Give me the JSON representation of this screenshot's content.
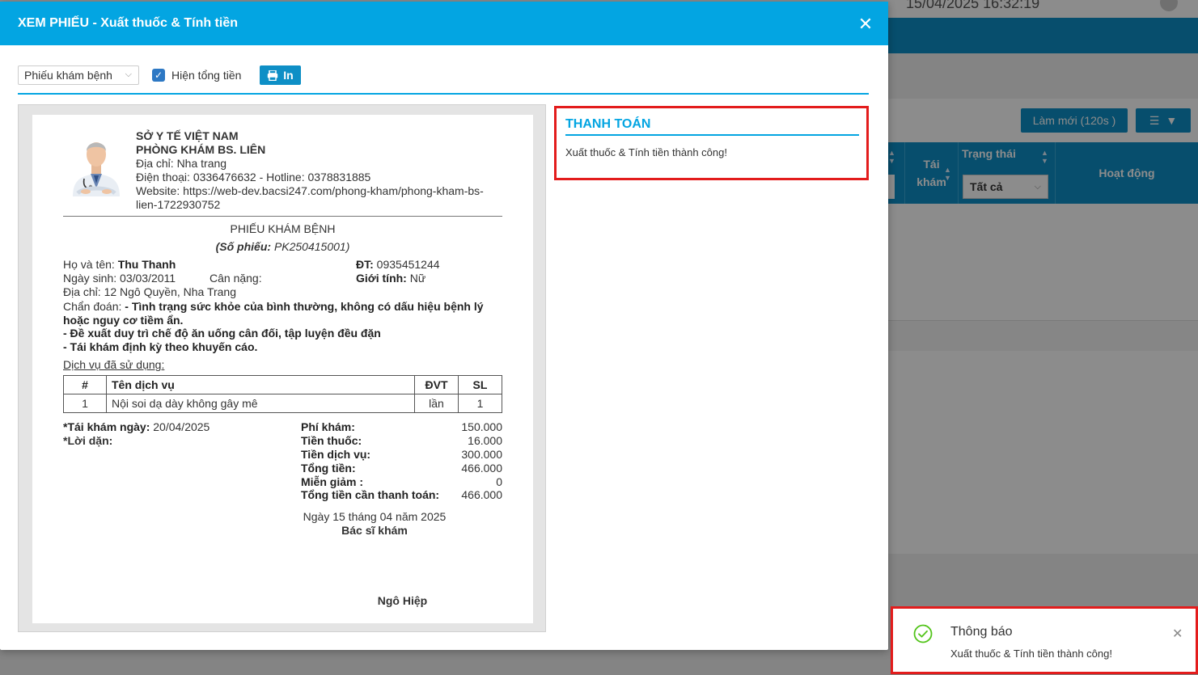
{
  "background": {
    "datetime": "15/04/2025 16:32:19",
    "refresh_button": "Làm mới (120s )",
    "columns": {
      "tai_kham": "Tái khám",
      "trang_thai": "Trạng thái",
      "hoat_dong": "Hoạt động"
    },
    "status_filter": "Tất cả"
  },
  "modal": {
    "title": "XEM PHIẾU - Xuất thuốc & Tính tiền",
    "toolbar": {
      "form_select": "Phiếu khám bệnh",
      "show_total_label": "Hiện tổng tiền",
      "print_label": "In"
    },
    "paper": {
      "org": "SỞ Y TẾ VIỆT NAM",
      "clinic": "PHÒNG KHÁM BS. LIÊN",
      "address": "Địa chỉ: Nha trang",
      "phone": "Điện thoại: 0336476632 - Hotline: 0378831885",
      "website": "Website: https://web-dev.bacsi247.com/phong-kham/phong-kham-bs-lien-1722930752",
      "doc_title": "PHIẾU KHÁM BỆNH",
      "doc_no_label": "(Số phiếu: ",
      "doc_no": "PK250415001",
      "doc_no_close": ")",
      "patient": {
        "name_label": "Họ và tên: ",
        "name": "Thu Thanh",
        "phone_label": "ĐT: ",
        "phone": "0935451244",
        "dob_label": "Ngày sinh: ",
        "dob": "03/03/2011",
        "weight_label": "Cân nặng:",
        "gender_label": "Giới tính: ",
        "gender": "Nữ",
        "address": "Địa chỉ: 12 Ngô Quyền, Nha Trang"
      },
      "diagnosis_label": "Chẩn đoán: ",
      "diagnosis_1": "- Tình trạng sức khỏe của bình thường, không có dấu hiệu bệnh lý hoặc nguy cơ tiềm ẩn.",
      "diagnosis_2": "- Đề xuất duy trì chế độ ăn uống cân đối, tập luyện đều đặn",
      "diagnosis_3": "- Tái khám định kỳ theo khuyến cáo.",
      "services_heading": "Dịch vụ đã sử dụng:",
      "services_headers": {
        "no": "#",
        "name": "Tên dịch vụ",
        "unit": "ĐVT",
        "qty": "SL"
      },
      "services": [
        {
          "no": "1",
          "name": "Nội soi dạ dày không gây mê",
          "unit": "lần",
          "qty": "1"
        }
      ],
      "revisit_label": "*Tái khám ngày: ",
      "revisit_date": "20/04/2025",
      "advice_label": "*Lời dặn:",
      "totals": [
        {
          "label": "Phí khám:",
          "value": "150.000"
        },
        {
          "label": "Tiền thuốc:",
          "value": "16.000"
        },
        {
          "label": "Tiền dịch vụ:",
          "value": "300.000"
        },
        {
          "label": "Tổng tiền:",
          "value": "466.000"
        },
        {
          "label": "Miễn giảm :",
          "value": "0"
        },
        {
          "label": "Tổng tiền cần thanh toán:",
          "value": "466.000"
        }
      ],
      "sign_date": "Ngày 15 tháng 04 năm 2025",
      "sign_role": "Bác sĩ khám",
      "sign_name": "Ngô Hiệp"
    },
    "payment": {
      "title": "THANH TOÁN",
      "message": "Xuất thuốc & Tính tiền thành công!"
    }
  },
  "toast": {
    "title": "Thông báo",
    "message": "Xuất thuốc & Tính tiền thành công!"
  },
  "colors": {
    "header_blue": "#03a5e2",
    "button_blue": "#0e8fc6",
    "highlight_red": "#e31c1c",
    "success_green": "#52c41a"
  }
}
